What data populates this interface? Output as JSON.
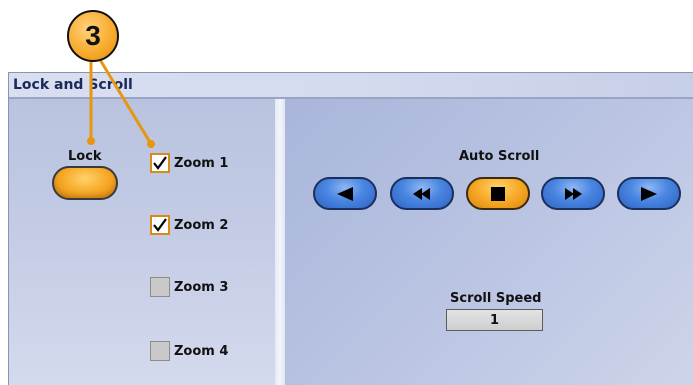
{
  "callout": {
    "number": "3"
  },
  "panel": {
    "title": "Lock and Scroll"
  },
  "lock": {
    "label": "Lock"
  },
  "zooms": [
    {
      "label": "Zoom 1",
      "checked": true
    },
    {
      "label": "Zoom 2",
      "checked": true
    },
    {
      "label": "Zoom 3",
      "checked": false
    },
    {
      "label": "Zoom 4",
      "checked": false
    }
  ],
  "auto_scroll": {
    "label": "Auto Scroll",
    "buttons": [
      "scroll-left",
      "fast-rewind",
      "stop",
      "fast-forward",
      "scroll-right"
    ]
  },
  "scroll_speed": {
    "label": "Scroll Speed",
    "value": "1"
  },
  "colors": {
    "accent_orange": "#f6a623",
    "button_blue": "#4a86e1",
    "panel_bg": "#c7cfe5",
    "title_text": "#1a2a5a"
  }
}
